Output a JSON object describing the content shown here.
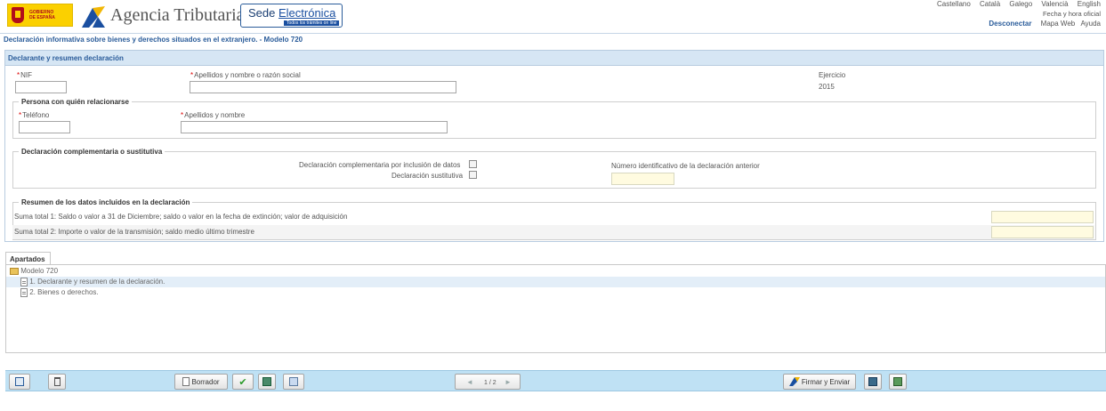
{
  "header": {
    "gobierno_line1": "GOBIERNO",
    "gobierno_line2": "DE ESPAÑA",
    "brand": "Agencia Tributaria",
    "sede_title_prefix": "Sede ",
    "sede_title_link": "Electrónica",
    "sede_subtitle": "Todos los trámites on line",
    "languages": [
      "Castellano",
      "Català",
      "Galego",
      "Valencià",
      "English"
    ],
    "fecha": "Fecha y hora oficial",
    "nav": {
      "disconnect": "Desconectar",
      "mapa": "Mapa Web",
      "ayuda": "Ayuda"
    }
  },
  "page_title": "Declaración informativa sobre bienes y derechos situados en el extranjero. - Modelo 720",
  "panel": {
    "title": "Declarante y resumen declaración",
    "nif_label": "NIF",
    "nif_value": "",
    "apellidos_label": "Apellidos y nombre o razón social",
    "apellidos_value": "",
    "ejercicio_label": "Ejercicio",
    "ejercicio_value": "2015",
    "required_mark": "*"
  },
  "persona": {
    "legend": "Persona con quién relacionarse",
    "telefono_label": "Teléfono",
    "apellidos_label": "Apellidos y nombre"
  },
  "complementaria": {
    "legend": "Declaración complementaria o sustitutiva",
    "complementaria_label": "Declaración complementaria por inclusión de datos",
    "sustitutiva_label": "Declaración sustitutiva",
    "numero_label": "Número identificativo de la declaración anterior"
  },
  "resumen": {
    "legend": "Resumen de los datos incluidos en la declaración",
    "suma1": "Suma total 1: Saldo o valor a 31 de Diciembre; saldo o valor en la fecha de extinción; valor de adquisición",
    "suma2": "Suma total 2: Importe o valor de la transmisión; saldo medio último trimestre"
  },
  "apartados": {
    "tab": "Apartados",
    "root": "Modelo 720",
    "items": [
      "1. Declarante y resumen de la declaración.",
      "2. Bienes o derechos."
    ],
    "selected_color": "#e3eef8"
  },
  "toolbar": {
    "borrador": "Borrador",
    "firmar": "Firmar y Enviar",
    "page": "1 / 2",
    "accent": "#bfe1f4"
  }
}
